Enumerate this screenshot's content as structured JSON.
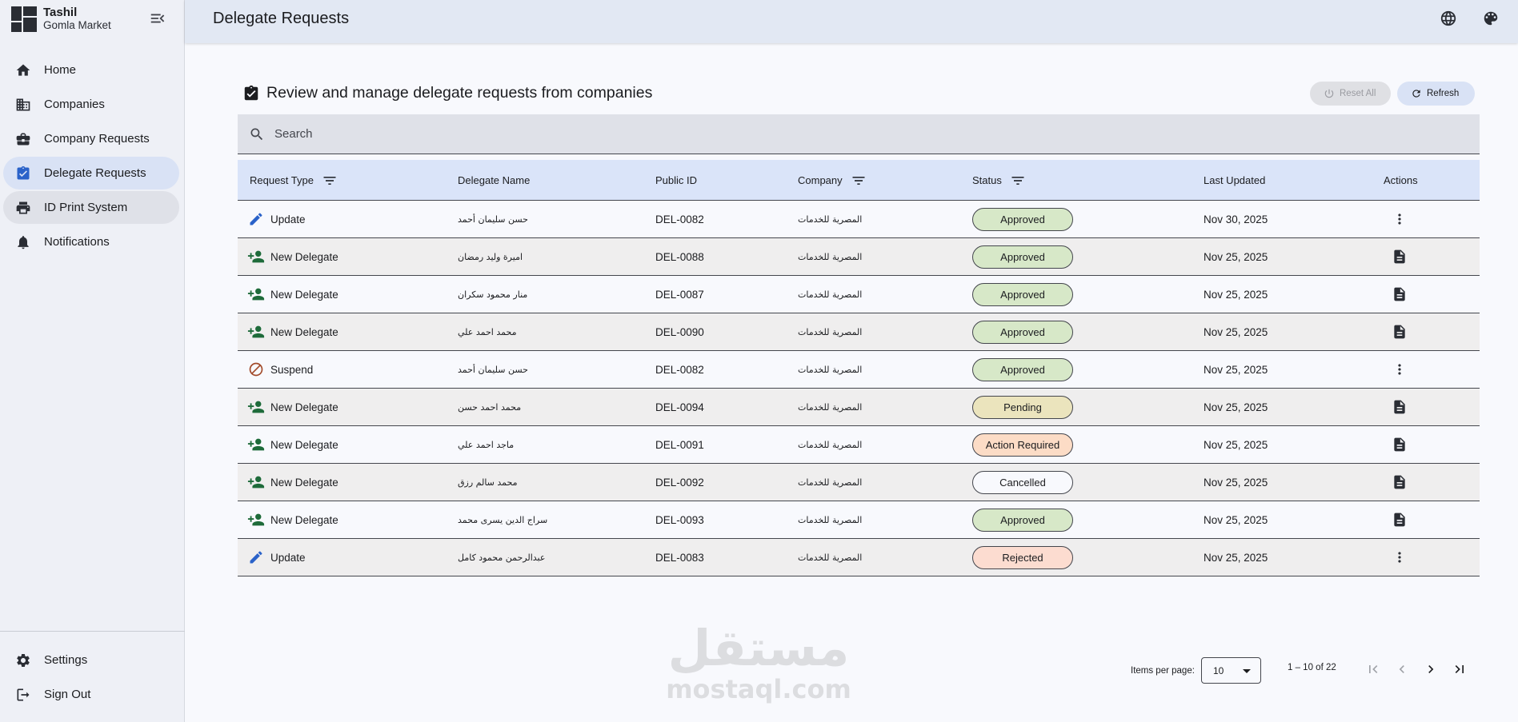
{
  "brand": {
    "title": "Tashil",
    "subtitle": "Gomla Market"
  },
  "sidebar": {
    "items": [
      {
        "label": "Home",
        "icon": "home-icon"
      },
      {
        "label": "Companies",
        "icon": "companies-icon"
      },
      {
        "label": "Company Requests",
        "icon": "briefcase-icon"
      },
      {
        "label": "Delegate Requests",
        "icon": "clipboard-check-icon",
        "active": true
      },
      {
        "label": "ID Print System",
        "icon": "printer-icon"
      },
      {
        "label": "Notifications",
        "icon": "bell-icon"
      }
    ],
    "bottom": [
      {
        "label": "Settings",
        "icon": "gear-icon"
      },
      {
        "label": "Sign Out",
        "icon": "logout-icon"
      }
    ]
  },
  "header": {
    "title": "Delegate Requests",
    "icons": [
      "globe-icon",
      "palette-icon"
    ]
  },
  "section": {
    "title": "Review and manage delegate requests from companies"
  },
  "buttons": {
    "reset": "Reset All",
    "refresh": "Refresh"
  },
  "search": {
    "placeholder": "Search",
    "value": ""
  },
  "table": {
    "columns": [
      "Request Type",
      "Delegate Name",
      "Public ID",
      "Company",
      "Status",
      "Last Updated",
      "Actions"
    ],
    "rows": [
      {
        "type": "Update",
        "type_icon": "pencil-icon",
        "name": "حسن سليمان أحمد",
        "id": "DEL-0082",
        "company": "المصرية للخدمات",
        "status": "Approved",
        "status_kind": "approved",
        "updated": "Nov 30, 2025",
        "action_icon": "more-vert-icon"
      },
      {
        "type": "New Delegate",
        "type_icon": "person-add-icon",
        "name": "اميرة وليد رمضان",
        "id": "DEL-0088",
        "company": "المصرية للخدمات",
        "status": "Approved",
        "status_kind": "approved",
        "updated": "Nov 25, 2025",
        "action_icon": "document-icon"
      },
      {
        "type": "New Delegate",
        "type_icon": "person-add-icon",
        "name": "منار محمود سكران",
        "id": "DEL-0087",
        "company": "المصرية للخدمات",
        "status": "Approved",
        "status_kind": "approved",
        "updated": "Nov 25, 2025",
        "action_icon": "document-icon"
      },
      {
        "type": "New Delegate",
        "type_icon": "person-add-icon",
        "name": "محمد احمد علي",
        "id": "DEL-0090",
        "company": "المصرية للخدمات",
        "status": "Approved",
        "status_kind": "approved",
        "updated": "Nov 25, 2025",
        "action_icon": "document-icon"
      },
      {
        "type": "Suspend",
        "type_icon": "block-icon",
        "name": "حسن سليمان أحمد",
        "id": "DEL-0082",
        "company": "المصرية للخدمات",
        "status": "Approved",
        "status_kind": "approved",
        "updated": "Nov 25, 2025",
        "action_icon": "more-vert-icon"
      },
      {
        "type": "New Delegate",
        "type_icon": "person-add-icon",
        "name": "محمد احمد حسن",
        "id": "DEL-0094",
        "company": "المصرية للخدمات",
        "status": "Pending",
        "status_kind": "pending",
        "updated": "Nov 25, 2025",
        "action_icon": "document-icon"
      },
      {
        "type": "New Delegate",
        "type_icon": "person-add-icon",
        "name": "ماجد احمد علي",
        "id": "DEL-0091",
        "company": "المصرية للخدمات",
        "status": "Action Required",
        "status_kind": "action",
        "updated": "Nov 25, 2025",
        "action_icon": "document-icon"
      },
      {
        "type": "New Delegate",
        "type_icon": "person-add-icon",
        "name": "محمد سالم رزق",
        "id": "DEL-0092",
        "company": "المصرية للخدمات",
        "status": "Cancelled",
        "status_kind": "cancelled",
        "updated": "Nov 25, 2025",
        "action_icon": "document-icon"
      },
      {
        "type": "New Delegate",
        "type_icon": "person-add-icon",
        "name": "سراج الدين يسرى محمد",
        "id": "DEL-0093",
        "company": "المصرية للخدمات",
        "status": "Approved",
        "status_kind": "approved",
        "updated": "Nov 25, 2025",
        "action_icon": "document-icon"
      },
      {
        "type": "Update",
        "type_icon": "pencil-icon",
        "name": "عبدالرحمن محمود كامل",
        "id": "DEL-0083",
        "company": "المصرية للخدمات",
        "status": "Rejected",
        "status_kind": "rejected",
        "updated": "Nov 25, 2025",
        "action_icon": "more-vert-icon"
      }
    ]
  },
  "paginator": {
    "items_label": "Items per page:",
    "page_size": "10",
    "range": "1 – 10 of 22"
  },
  "watermark": {
    "arabic": "مستقل",
    "latin": "mostaql.com"
  },
  "colors": {
    "sidebar_bg": "#eef0f6",
    "active_nav": "#d9e2f5",
    "header_bg": "#e2e8f3",
    "table_header": "#dae4f9",
    "approved": "#d7e8c8",
    "pending": "#ebe4bd",
    "action_required": "#fcdcc6",
    "rejected": "#fcdcd0",
    "add_icon": "#1e6b3a",
    "edit_icon": "#2a62c9",
    "suspend_icon": "#a24a2a"
  }
}
